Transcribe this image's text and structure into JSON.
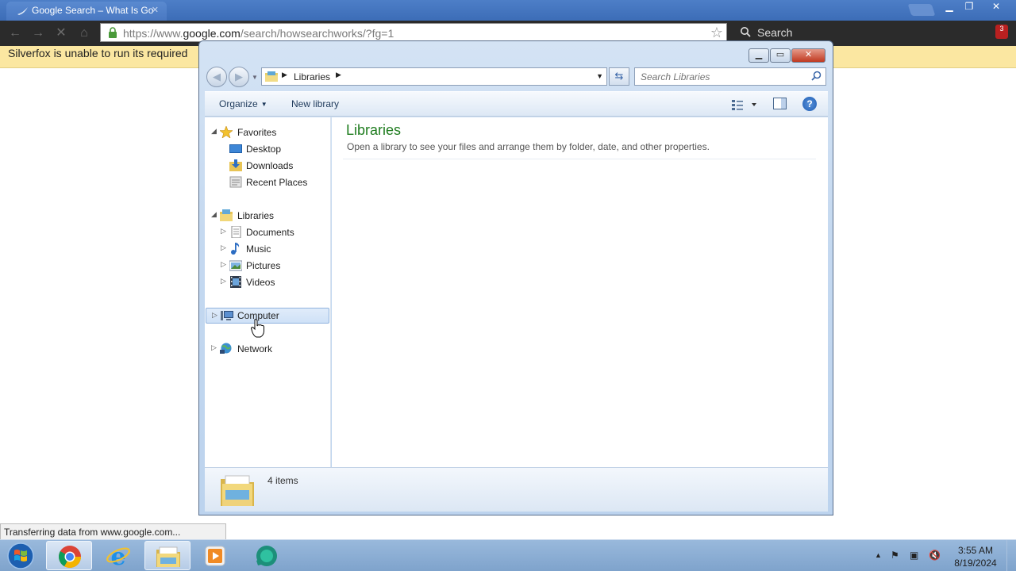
{
  "browser": {
    "tab_title": "Google Search – What Is Go",
    "url_prefix": "https://www.",
    "url_domain": "google.com",
    "url_path": "/search/howsearchworks/?fg=1",
    "search_label": "Search",
    "extension_badge": "3",
    "infobar_text": "Silverfox is unable to run its required",
    "status_text": "Transferring data from www.google.com..."
  },
  "explorer": {
    "breadcrumb": "Libraries",
    "search_placeholder": "Search Libraries",
    "toolbar": {
      "organize_label": "Organize",
      "new_library_label": "New library"
    },
    "nav": {
      "favorites": "Favorites",
      "desktop": "Desktop",
      "downloads": "Downloads",
      "recent_places": "Recent Places",
      "libraries": "Libraries",
      "documents": "Documents",
      "music": "Music",
      "pictures": "Pictures",
      "videos": "Videos",
      "computer": "Computer",
      "network": "Network"
    },
    "content": {
      "title": "Libraries",
      "subtitle": "Open a library to see your files and arrange them by folder, date, and other properties."
    },
    "details": {
      "item_count": "4 items"
    }
  },
  "taskbar": {
    "time": "3:55 AM",
    "date": "8/19/2024"
  },
  "colors": {
    "title_green": "#1e7c1e",
    "infobar_yellow": "#fbe7a1",
    "selection_blue": "#cfe1f7"
  },
  "icons": [
    "chrome-tab-favicon",
    "lock-icon",
    "star-icon",
    "search-icon",
    "favorites-star-icon",
    "desktop-icon",
    "downloads-icon",
    "recent-places-icon",
    "libraries-icon",
    "documents-icon",
    "music-icon",
    "pictures-icon",
    "videos-icon",
    "computer-icon",
    "network-icon",
    "help-icon",
    "windows-start-icon",
    "chrome-icon",
    "internet-explorer-icon",
    "explorer-icon",
    "media-player-icon",
    "app-icon",
    "flag-icon",
    "network-tray-icon",
    "volume-muted-icon"
  ]
}
